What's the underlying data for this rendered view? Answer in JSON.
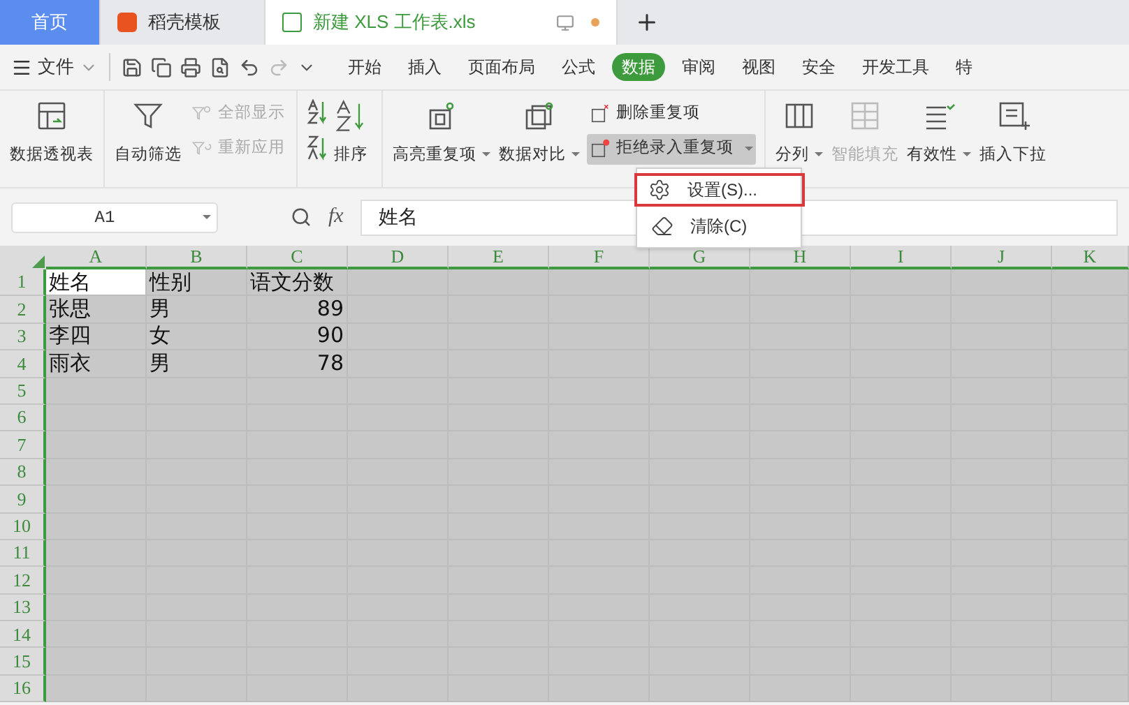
{
  "tabs": [
    {
      "kind": "home",
      "label": "首页",
      "selected": false
    },
    {
      "kind": "template",
      "label": "稻壳模板",
      "selected": false
    },
    {
      "kind": "file",
      "label": "新建 XLS 工作表.xls",
      "selected": true
    }
  ],
  "menu": {
    "file_menu": "文件",
    "ribbon_tabs": [
      {
        "label": "开始",
        "selected": false
      },
      {
        "label": "插入",
        "selected": false
      },
      {
        "label": "页面布局",
        "selected": false
      },
      {
        "label": "公式",
        "selected": false
      },
      {
        "label": "数据",
        "selected": true
      },
      {
        "label": "审阅",
        "selected": false
      },
      {
        "label": "视图",
        "selected": false
      },
      {
        "label": "安全",
        "selected": false
      },
      {
        "label": "开发工具",
        "selected": false
      },
      {
        "label": "特",
        "selected": false
      }
    ]
  },
  "ribbon": [
    {
      "kind": "big",
      "label": "数据透视表",
      "dropdown": false,
      "disabled": false
    },
    {
      "kind": "big",
      "label": "自动筛选",
      "dropdown": false,
      "disabled": false
    },
    {
      "kind": "stack",
      "items": [
        {
          "label": "全部显示",
          "disabled": true
        },
        {
          "label": "重新应用",
          "disabled": true
        }
      ]
    },
    {
      "kind": "sort",
      "label": "排序"
    },
    {
      "kind": "big",
      "label": "高亮重复项",
      "dropdown": true,
      "disabled": false
    },
    {
      "kind": "big",
      "label": "数据对比",
      "dropdown": true,
      "disabled": false
    },
    {
      "kind": "stack",
      "items": [
        {
          "label": "删除重复项",
          "disabled": false,
          "dropdown": false,
          "pressed": false
        },
        {
          "label": "拒绝录入重复项",
          "disabled": false,
          "dropdown": true,
          "pressed": true
        }
      ]
    },
    {
      "kind": "big",
      "label": "分列",
      "dropdown": true,
      "disabled": false
    },
    {
      "kind": "big",
      "label": "智能填充",
      "dropdown": false,
      "disabled": true
    },
    {
      "kind": "big",
      "label": "有效性",
      "dropdown": true,
      "disabled": false
    },
    {
      "kind": "big",
      "label": "插入下拉",
      "dropdown": false,
      "disabled": false
    }
  ],
  "dropdown_menu": [
    {
      "label": "设置(S)...",
      "selected": true
    },
    {
      "label": "清除(C)",
      "selected": false
    }
  ],
  "formula_bar": {
    "name_box": "A1",
    "fx": "fx",
    "value": "姓名"
  },
  "sheet": {
    "columns": [
      "A",
      "B",
      "C",
      "D",
      "E",
      "F",
      "G",
      "H",
      "I",
      "J",
      "K"
    ],
    "rows": [
      {
        "number": "1",
        "cells": [
          "姓名",
          "性别",
          "语文分数"
        ]
      },
      {
        "number": "2",
        "cells": [
          "张思",
          "男",
          "89"
        ]
      },
      {
        "number": "3",
        "cells": [
          "李四",
          "女",
          "90"
        ]
      },
      {
        "number": "4",
        "cells": [
          "雨衣",
          "男",
          "78"
        ]
      },
      {
        "number": "5",
        "cells": []
      },
      {
        "number": "6",
        "cells": []
      },
      {
        "number": "7",
        "cells": []
      },
      {
        "number": "8",
        "cells": []
      },
      {
        "number": "9",
        "cells": []
      },
      {
        "number": "10",
        "cells": []
      },
      {
        "number": "11",
        "cells": []
      },
      {
        "number": "12",
        "cells": []
      },
      {
        "number": "13",
        "cells": []
      },
      {
        "number": "14",
        "cells": []
      },
      {
        "number": "15",
        "cells": []
      },
      {
        "number": "16",
        "cells": []
      }
    ]
  }
}
